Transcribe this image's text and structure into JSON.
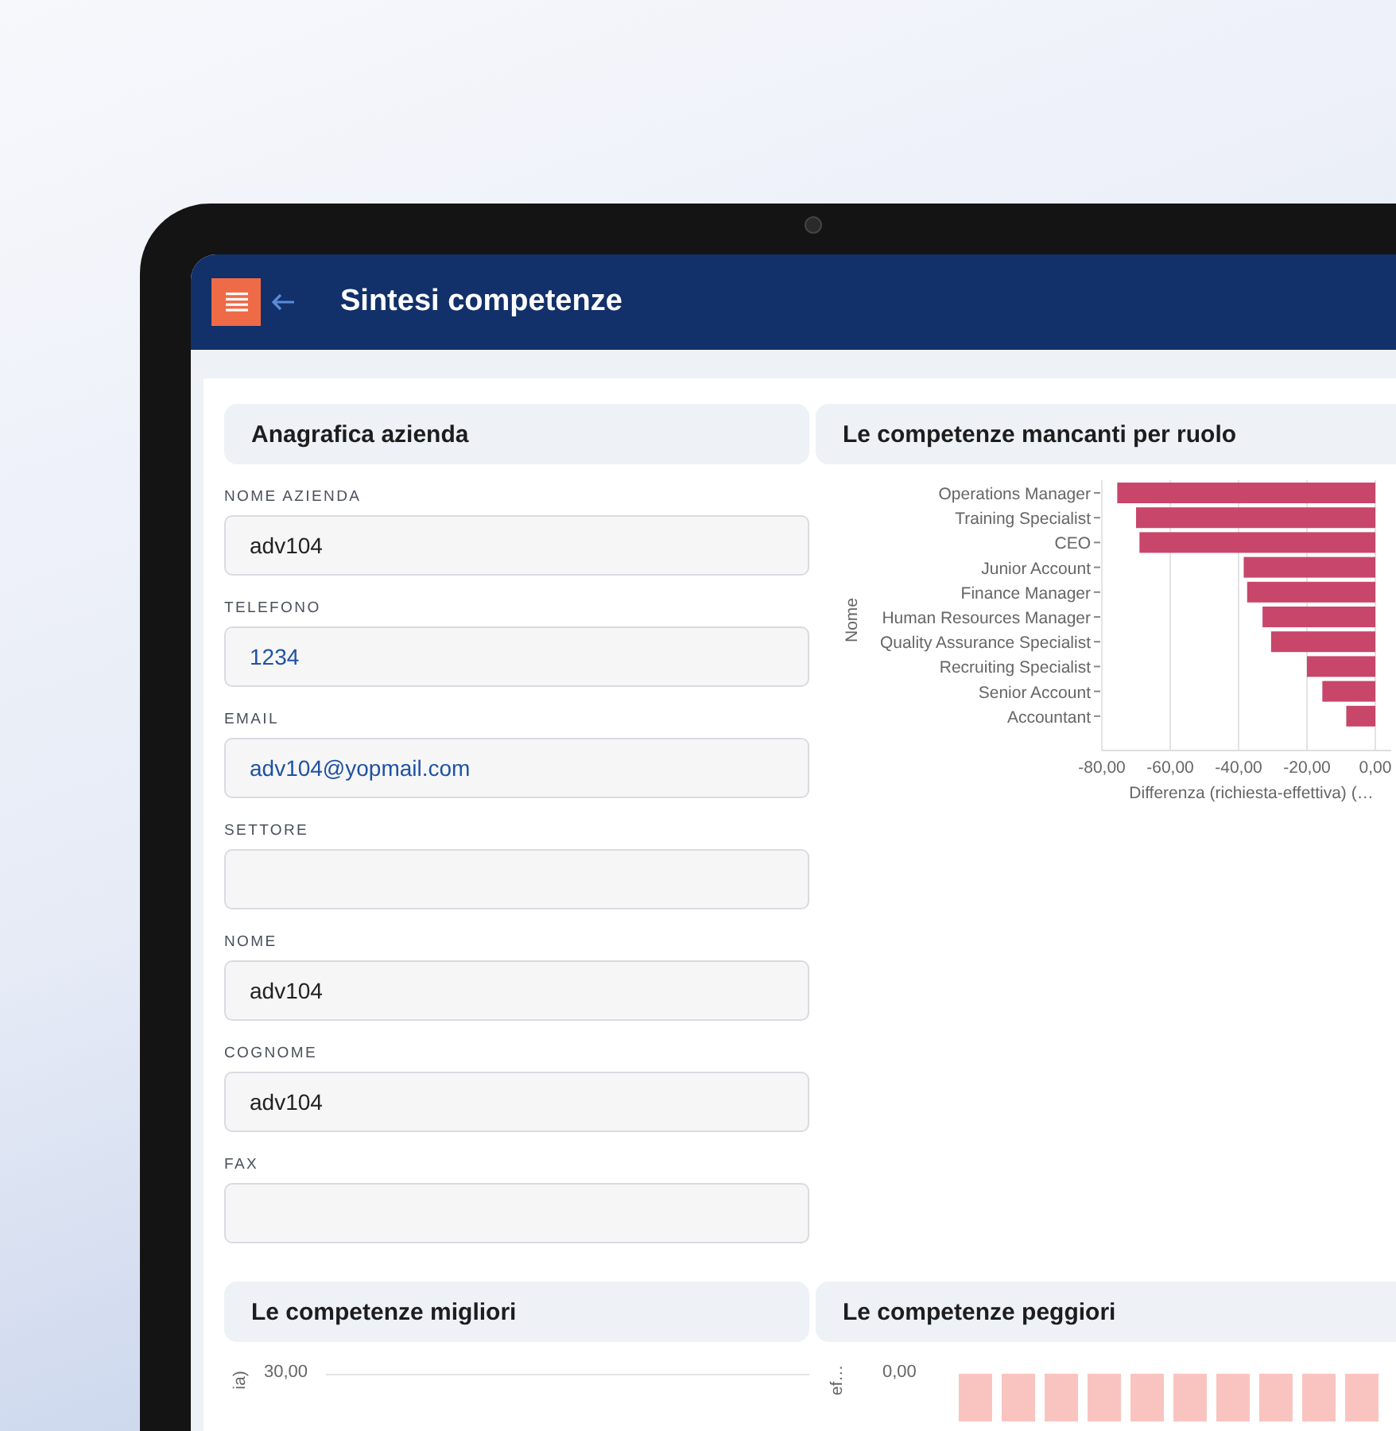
{
  "header": {
    "title": "Sintesi competenze"
  },
  "company_panel": {
    "title": "Anagrafica azienda",
    "fields": [
      {
        "label": "NOME AZIENDA",
        "value": "adv104",
        "kind": "text"
      },
      {
        "label": "TELEFONO",
        "value": "1234",
        "kind": "link"
      },
      {
        "label": "EMAIL",
        "value": "adv104@yopmail.com",
        "kind": "link"
      },
      {
        "label": "SETTORE",
        "kind": "text"
      },
      {
        "label": "NOME",
        "value": "adv104",
        "kind": "text"
      },
      {
        "label": "COGNOME",
        "value": "adv104",
        "kind": "text"
      },
      {
        "label": "FAX",
        "kind": "text"
      }
    ]
  },
  "missing_panel": {
    "title": "Le competenze mancanti per ruolo",
    "chart_data": {
      "type": "bar",
      "orientation": "horizontal",
      "xlabel": "Differenza (richiesta-effettiva) (…",
      "ylabel": "Nome",
      "categories": [
        "Operations Manager",
        "Training Specialist",
        "CEO",
        "Junior Account",
        "Finance Manager",
        "Human Resources Manager",
        "Quality Assurance Specialist",
        "Recruiting Specialist",
        "Senior Account",
        "Accountant"
      ],
      "values": [
        -75.5,
        -70,
        -69,
        -38.5,
        -37.5,
        -33,
        -30.5,
        -20,
        -15.5,
        -8.5
      ],
      "xlim": [
        -80,
        0
      ],
      "grid": true,
      "xticks": [
        {
          "value": -80,
          "label": "-80,00"
        },
        {
          "value": -60,
          "label": "-60,00"
        },
        {
          "value": -40,
          "label": "-40,00"
        },
        {
          "value": -20,
          "label": "-20,00"
        },
        {
          "value": 0,
          "label": "0,00"
        }
      ]
    }
  },
  "best_panel": {
    "title": "Le competenze migliori",
    "y_tick": "30,00",
    "ylabel_fragment": "ia)"
  },
  "worst_panel": {
    "title": "Le competenze peggiori",
    "y_tick": "0,00",
    "ylabel_fragment": "ef…"
  }
}
